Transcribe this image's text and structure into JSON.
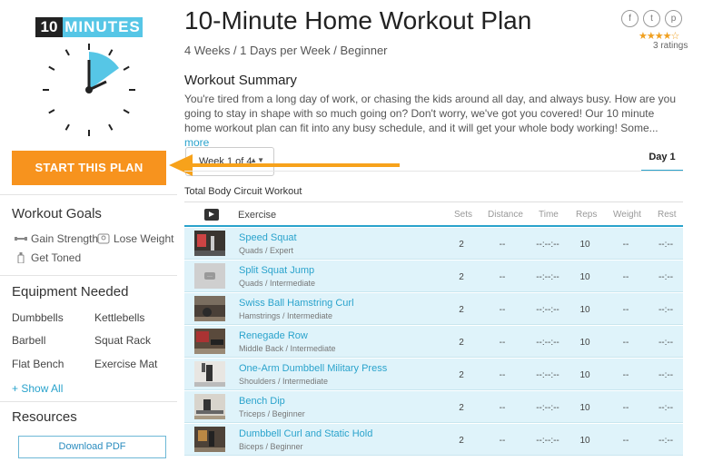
{
  "logo": {
    "number": "10",
    "word": "MINUTES"
  },
  "sidebar": {
    "start_label": "START THIS PLAN",
    "goals_title": "Workout Goals",
    "goals": [
      {
        "label": "Gain Strength",
        "icon": "dumbbell-icon"
      },
      {
        "label": "Lose Weight",
        "icon": "scale-icon"
      },
      {
        "label": "Get Toned",
        "icon": "bottle-icon"
      }
    ],
    "equipment_title": "Equipment Needed",
    "equipment": [
      "Dumbbells",
      "Kettlebells",
      "Barbell",
      "Squat Rack",
      "Flat Bench",
      "Exercise Mat"
    ],
    "show_all_label": "+ Show All",
    "resources_title": "Resources",
    "download_label": "Download PDF"
  },
  "header": {
    "title": "10-Minute Home Workout Plan",
    "subtitle": "4 Weeks / 1 Days per Week / Beginner",
    "social": [
      {
        "icon": "facebook-icon",
        "glyph": "f"
      },
      {
        "icon": "twitter-icon",
        "glyph": "t"
      },
      {
        "icon": "pinterest-icon",
        "glyph": "p"
      }
    ],
    "rating_stars": "★★★★☆",
    "rating_value": 4,
    "ratings_count": "3 ratings"
  },
  "summary": {
    "title": "Workout Summary",
    "text": "You're tired from a long day of work, or chasing the kids around all day, and always busy. How are you going to stay in shape with so much going on? Don't worry, we've got you covered! Our 10 minute home workout plan can fit into any busy schedule, and it will get your whole body working! Some...",
    "more_label": "more"
  },
  "week_select": {
    "value": "Week 1 of 4"
  },
  "day_tab": "Day 1",
  "workout_name": "Total Body Circuit Workout",
  "table": {
    "headers": {
      "exercise": "Exercise",
      "sets": "Sets",
      "distance": "Distance",
      "time": "Time",
      "reps": "Reps",
      "weight": "Weight",
      "rest": "Rest"
    },
    "rows": [
      {
        "name": "Speed Squat",
        "sub": "Quads / Expert",
        "sets": "2",
        "distance": "--",
        "time": "--:--:--",
        "reps": "10",
        "weight": "--",
        "rest": "--:--"
      },
      {
        "name": "Split Squat Jump",
        "sub": "Quads / Intermediate",
        "sets": "2",
        "distance": "--",
        "time": "--:--:--",
        "reps": "10",
        "weight": "--",
        "rest": "--:--"
      },
      {
        "name": "Swiss Ball Hamstring Curl",
        "sub": "Hamstrings / Intermediate",
        "sets": "2",
        "distance": "--",
        "time": "--:--:--",
        "reps": "10",
        "weight": "--",
        "rest": "--:--"
      },
      {
        "name": "Renegade Row",
        "sub": "Middle Back / Intermediate",
        "sets": "2",
        "distance": "--",
        "time": "--:--:--",
        "reps": "10",
        "weight": "--",
        "rest": "--:--"
      },
      {
        "name": "One-Arm Dumbbell Military Press",
        "sub": "Shoulders / Intermediate",
        "sets": "2",
        "distance": "--",
        "time": "--:--:--",
        "reps": "10",
        "weight": "--",
        "rest": "--:--"
      },
      {
        "name": "Bench Dip",
        "sub": "Triceps / Beginner",
        "sets": "2",
        "distance": "--",
        "time": "--:--:--",
        "reps": "10",
        "weight": "--",
        "rest": "--:--"
      },
      {
        "name": "Dumbbell Curl and Static Hold",
        "sub": "Biceps / Beginner",
        "sets": "2",
        "distance": "--",
        "time": "--:--:--",
        "reps": "10",
        "weight": "--",
        "rest": "--:--"
      }
    ]
  },
  "colors": {
    "accent": "#2aa3cc",
    "cta": "#f7931e",
    "row_bg": "#dff3fa"
  }
}
